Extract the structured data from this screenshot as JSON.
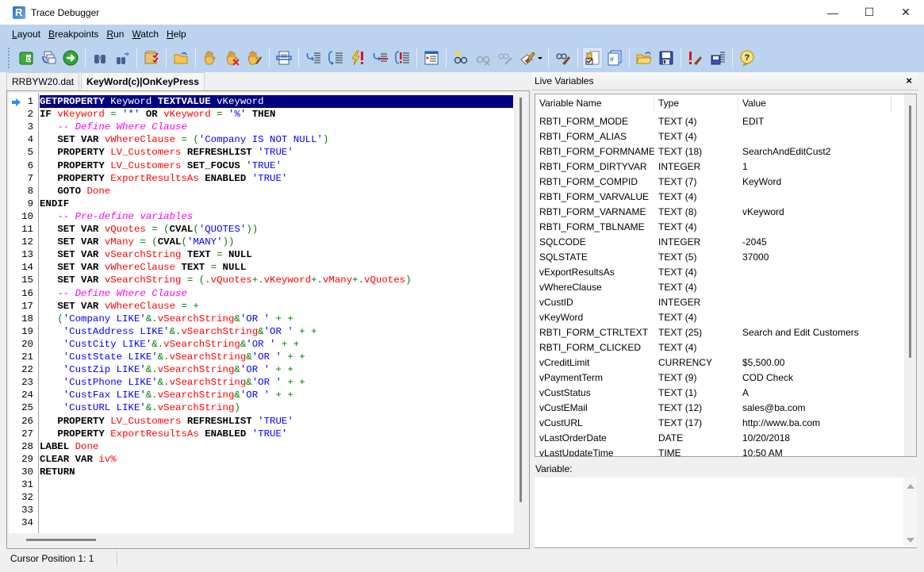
{
  "window": {
    "title": "Trace Debugger",
    "minimize": "—",
    "maximize": "☐",
    "close": "✕"
  },
  "menu": [
    {
      "label": "Layout",
      "accel": "L",
      "rest": "ayout"
    },
    {
      "label": "Breakpoints",
      "accel": "B",
      "rest": "reakpoints"
    },
    {
      "label": "Run",
      "accel": "R",
      "rest": "un"
    },
    {
      "label": "Watch",
      "accel": "W",
      "rest": "atch"
    },
    {
      "label": "Help",
      "accel": "H",
      "rest": "elp"
    }
  ],
  "toolbar": {
    "buttons": [
      {
        "icon": "open-database-icon"
      },
      {
        "icon": "copy-windows-icon"
      },
      {
        "icon": "run-green-arrow-icon"
      },
      {
        "sep": true
      },
      {
        "icon": "find-binoculars-icon"
      },
      {
        "icon": "find-next-icon"
      },
      {
        "sep": true
      },
      {
        "icon": "database-check-icon"
      },
      {
        "sep": true
      },
      {
        "icon": "folder-undo-icon"
      },
      {
        "sep": true
      },
      {
        "icon": "stop-hand-icon"
      },
      {
        "icon": "remove-hand-icon"
      },
      {
        "icon": "clear-hand-icon"
      },
      {
        "sep": true
      },
      {
        "icon": "print-icon"
      },
      {
        "sep": true
      },
      {
        "icon": "step-into-icon"
      },
      {
        "icon": "step-over-icon"
      },
      {
        "icon": "break-exception-icon"
      },
      {
        "icon": "skip-line-icon"
      },
      {
        "icon": "step-out-icon"
      },
      {
        "sep": true
      },
      {
        "icon": "window-list-icon"
      },
      {
        "sep": true
      },
      {
        "icon": "add-watch-icon"
      },
      {
        "icon": "remove-watch-icon",
        "disabled": true
      },
      {
        "icon": "edit-watch-icon",
        "disabled": true
      },
      {
        "icon": "edit-pencil-dropdown-icon"
      },
      {
        "sep": true
      },
      {
        "icon": "clear-watch-icon"
      },
      {
        "sep": true
      },
      {
        "icon": "live-variables-icon",
        "active": true
      },
      {
        "icon": "window-hash-icon"
      },
      {
        "sep": true
      },
      {
        "icon": "open-folder-icon"
      },
      {
        "icon": "save-disk-icon"
      },
      {
        "sep": true
      },
      {
        "icon": "clear-errors-icon"
      },
      {
        "icon": "save-log-icon"
      },
      {
        "sep": true
      },
      {
        "icon": "help-question-icon"
      }
    ]
  },
  "tabs": [
    {
      "label": "RRBYW20.dat",
      "active": false
    },
    {
      "label": "KeyWord(c)|OnKeyPress",
      "active": true
    }
  ],
  "editor": {
    "current_line": 1,
    "lines": [
      [
        [
          "kw",
          "GETPROPERTY"
        ],
        [
          "plain",
          " Keyword "
        ],
        [
          "kw",
          "TEXTVALUE"
        ],
        [
          "plain",
          " vKeyword"
        ]
      ],
      [
        [
          "kw",
          "IF"
        ],
        [
          "plain",
          " "
        ],
        [
          "var",
          "vKeyword"
        ],
        [
          "op",
          " = "
        ],
        [
          "str",
          "'*'"
        ],
        [
          "plain",
          " "
        ],
        [
          "kw",
          "OR"
        ],
        [
          "plain",
          " "
        ],
        [
          "var",
          "vKeyword"
        ],
        [
          "op",
          " = "
        ],
        [
          "str",
          "'%'"
        ],
        [
          "plain",
          " "
        ],
        [
          "kw",
          "THEN"
        ]
      ],
      [
        [
          "plain",
          "   "
        ],
        [
          "cmt",
          "-- Define Where Clause"
        ]
      ],
      [
        [
          "plain",
          "   "
        ],
        [
          "kw",
          "SET VAR"
        ],
        [
          "plain",
          " "
        ],
        [
          "var",
          "vWhereClause"
        ],
        [
          "op",
          " = ("
        ],
        [
          "str",
          "'Company IS NOT NULL'"
        ],
        [
          "op",
          ")"
        ]
      ],
      [
        [
          "plain",
          "   "
        ],
        [
          "kw",
          "PROPERTY"
        ],
        [
          "plain",
          " "
        ],
        [
          "var",
          "LV_Customers"
        ],
        [
          "plain",
          " "
        ],
        [
          "kw",
          "REFRESHLIST"
        ],
        [
          "plain",
          " "
        ],
        [
          "str",
          "'TRUE'"
        ]
      ],
      [
        [
          "plain",
          "   "
        ],
        [
          "kw",
          "PROPERTY"
        ],
        [
          "plain",
          " "
        ],
        [
          "var",
          "LV_Customers"
        ],
        [
          "plain",
          " "
        ],
        [
          "kw",
          "SET_FOCUS"
        ],
        [
          "plain",
          " "
        ],
        [
          "str",
          "'TRUE'"
        ]
      ],
      [
        [
          "plain",
          "   "
        ],
        [
          "kw",
          "PROPERTY"
        ],
        [
          "plain",
          " "
        ],
        [
          "var",
          "ExportResultsAs"
        ],
        [
          "plain",
          " "
        ],
        [
          "kw",
          "ENABLED"
        ],
        [
          "plain",
          " "
        ],
        [
          "str",
          "'TRUE'"
        ]
      ],
      [
        [
          "plain",
          "   "
        ],
        [
          "kw",
          "GOTO"
        ],
        [
          "plain",
          " "
        ],
        [
          "var",
          "Done"
        ]
      ],
      [
        [
          "kw",
          "ENDIF"
        ]
      ],
      [
        [
          "plain",
          "   "
        ],
        [
          "cmt",
          "-- Pre-define variables"
        ]
      ],
      [
        [
          "plain",
          "   "
        ],
        [
          "kw",
          "SET VAR"
        ],
        [
          "plain",
          " "
        ],
        [
          "var",
          "vQuotes"
        ],
        [
          "op",
          " = ("
        ],
        [
          "kw",
          "CVAL"
        ],
        [
          "op",
          "("
        ],
        [
          "str",
          "'QUOTES'"
        ],
        [
          "op",
          "))"
        ]
      ],
      [
        [
          "plain",
          "   "
        ],
        [
          "kw",
          "SET VAR"
        ],
        [
          "plain",
          " "
        ],
        [
          "var",
          "vMany"
        ],
        [
          "op",
          " = ("
        ],
        [
          "kw",
          "CVAL"
        ],
        [
          "op",
          "("
        ],
        [
          "str",
          "'MANY'"
        ],
        [
          "op",
          "))"
        ]
      ],
      [
        [
          "plain",
          "   "
        ],
        [
          "kw",
          "SET VAR"
        ],
        [
          "plain",
          " "
        ],
        [
          "var",
          "vSearchString"
        ],
        [
          "plain",
          " "
        ],
        [
          "kw",
          "TEXT"
        ],
        [
          "op",
          " = "
        ],
        [
          "kw",
          "NULL"
        ]
      ],
      [
        [
          "plain",
          "   "
        ],
        [
          "kw",
          "SET VAR"
        ],
        [
          "plain",
          " "
        ],
        [
          "var",
          "vWhereClause"
        ],
        [
          "plain",
          " "
        ],
        [
          "kw",
          "TEXT"
        ],
        [
          "op",
          " = "
        ],
        [
          "kw",
          "NULL"
        ]
      ],
      [
        [
          "plain",
          "   "
        ],
        [
          "kw",
          "SET VAR"
        ],
        [
          "plain",
          " "
        ],
        [
          "var",
          "vSearchString"
        ],
        [
          "op",
          " = (."
        ],
        [
          "var",
          "vQuotes"
        ],
        [
          "op",
          "+."
        ],
        [
          "var",
          "vKeyword"
        ],
        [
          "op",
          "+."
        ],
        [
          "var",
          "vMany"
        ],
        [
          "op",
          "+."
        ],
        [
          "var",
          "vQuotes"
        ],
        [
          "op",
          ")"
        ]
      ],
      [
        [
          "plain",
          "   "
        ],
        [
          "cmt",
          "-- Define Where Clause"
        ]
      ],
      [
        [
          "plain",
          "   "
        ],
        [
          "kw",
          "SET VAR"
        ],
        [
          "plain",
          " "
        ],
        [
          "var",
          "vWhereClause"
        ],
        [
          "op",
          " = +"
        ]
      ],
      [
        [
          "plain",
          "   "
        ],
        [
          "op",
          "("
        ],
        [
          "str",
          "'Company LIKE'"
        ],
        [
          "op",
          "&."
        ],
        [
          "var",
          "vSearchString"
        ],
        [
          "op",
          "&"
        ],
        [
          "str",
          "'OR '"
        ],
        [
          "op",
          " + +"
        ]
      ],
      [
        [
          "plain",
          "    "
        ],
        [
          "str",
          "'CustAddress LIKE'"
        ],
        [
          "op",
          "&."
        ],
        [
          "var",
          "vSearchString"
        ],
        [
          "op",
          "&"
        ],
        [
          "str",
          "'OR '"
        ],
        [
          "op",
          " + +"
        ]
      ],
      [
        [
          "plain",
          "    "
        ],
        [
          "str",
          "'CustCity LIKE'"
        ],
        [
          "op",
          "&."
        ],
        [
          "var",
          "vSearchString"
        ],
        [
          "op",
          "&"
        ],
        [
          "str",
          "'OR '"
        ],
        [
          "op",
          " + +"
        ]
      ],
      [
        [
          "plain",
          "    "
        ],
        [
          "str",
          "'CustState LIKE'"
        ],
        [
          "op",
          "&."
        ],
        [
          "var",
          "vSearchString"
        ],
        [
          "op",
          "&"
        ],
        [
          "str",
          "'OR '"
        ],
        [
          "op",
          " + +"
        ]
      ],
      [
        [
          "plain",
          "    "
        ],
        [
          "str",
          "'CustZip LIKE'"
        ],
        [
          "op",
          "&."
        ],
        [
          "var",
          "vSearchString"
        ],
        [
          "op",
          "&"
        ],
        [
          "str",
          "'OR '"
        ],
        [
          "op",
          " + +"
        ]
      ],
      [
        [
          "plain",
          "    "
        ],
        [
          "str",
          "'CustPhone LIKE'"
        ],
        [
          "op",
          "&."
        ],
        [
          "var",
          "vSearchString"
        ],
        [
          "op",
          "&"
        ],
        [
          "str",
          "'OR '"
        ],
        [
          "op",
          " + +"
        ]
      ],
      [
        [
          "plain",
          "    "
        ],
        [
          "str",
          "'CustFax LIKE'"
        ],
        [
          "op",
          "&."
        ],
        [
          "var",
          "vSearchString"
        ],
        [
          "op",
          "&"
        ],
        [
          "str",
          "'OR '"
        ],
        [
          "op",
          " + +"
        ]
      ],
      [
        [
          "plain",
          "    "
        ],
        [
          "str",
          "'CustURL LIKE'"
        ],
        [
          "op",
          "&."
        ],
        [
          "var",
          "vSearchString"
        ],
        [
          "op",
          ")"
        ]
      ],
      [
        [
          "plain",
          "   "
        ],
        [
          "kw",
          "PROPERTY"
        ],
        [
          "plain",
          " "
        ],
        [
          "var",
          "LV_Customers"
        ],
        [
          "plain",
          " "
        ],
        [
          "kw",
          "REFRESHLIST"
        ],
        [
          "plain",
          " "
        ],
        [
          "str",
          "'TRUE'"
        ]
      ],
      [
        [
          "plain",
          "   "
        ],
        [
          "kw",
          "PROPERTY"
        ],
        [
          "plain",
          " "
        ],
        [
          "var",
          "ExportResultsAs"
        ],
        [
          "plain",
          " "
        ],
        [
          "kw",
          "ENABLED"
        ],
        [
          "plain",
          " "
        ],
        [
          "str",
          "'TRUE'"
        ]
      ],
      [
        [
          "kw",
          "LABEL"
        ],
        [
          "plain",
          " "
        ],
        [
          "var",
          "Done"
        ]
      ],
      [
        [
          "kw",
          "CLEAR VAR"
        ],
        [
          "plain",
          " "
        ],
        [
          "var",
          "iv%"
        ]
      ],
      [
        [
          "kw",
          "RETURN"
        ]
      ],
      [],
      [],
      [],
      []
    ]
  },
  "status": {
    "cursor_position": "Cursor Position 1: 1"
  },
  "live_variables": {
    "title": "Live Variables",
    "close": "×",
    "columns": [
      "Variable Name",
      "Type",
      "Value"
    ],
    "rows": [
      [
        "RBTI_FORM_MODE",
        "TEXT (4)",
        "EDIT"
      ],
      [
        "RBTI_FORM_ALIAS",
        "TEXT (4)",
        ""
      ],
      [
        "RBTI_FORM_FORMNAME",
        "TEXT (18)",
        "SearchAndEditCust2"
      ],
      [
        "RBTI_FORM_DIRTYVAR",
        "INTEGER",
        "1"
      ],
      [
        "RBTI_FORM_COMPID",
        "TEXT (7)",
        "KeyWord"
      ],
      [
        "RBTI_FORM_VARVALUE",
        "TEXT (4)",
        ""
      ],
      [
        "RBTI_FORM_VARNAME",
        "TEXT (8)",
        "vKeyword"
      ],
      [
        "RBTI_FORM_TBLNAME",
        "TEXT (4)",
        ""
      ],
      [
        "SQLCODE",
        "INTEGER",
        "-2045"
      ],
      [
        "SQLSTATE",
        "TEXT (5)",
        "37000"
      ],
      [
        "vExportResultsAs",
        "TEXT (4)",
        ""
      ],
      [
        "vWhereClause",
        "TEXT (4)",
        ""
      ],
      [
        "vCustID",
        "INTEGER",
        ""
      ],
      [
        "vKeyWord",
        "TEXT (4)",
        ""
      ],
      [
        "RBTI_FORM_CTRLTEXT",
        "TEXT (25)",
        "Search and Edit Customers"
      ],
      [
        "RBTI_FORM_CLICKED",
        "TEXT (4)",
        ""
      ],
      [
        "vCreditLimit",
        "CURRENCY",
        "$5,500.00"
      ],
      [
        "vPaymentTerm",
        "TEXT (9)",
        "COD Check"
      ],
      [
        "vCustStatus",
        "TEXT (1)",
        "A"
      ],
      [
        "vCustEMail",
        "TEXT (12)",
        "sales@ba.com"
      ],
      [
        "vCustURL",
        "TEXT (17)",
        "http://www.ba.com"
      ],
      [
        "vLastOrderDate",
        "DATE",
        "10/20/2018"
      ],
      [
        "vLastUpdateTime",
        "TIME",
        "10:50 AM"
      ]
    ],
    "variable_label": "Variable:",
    "variable_value": ""
  }
}
